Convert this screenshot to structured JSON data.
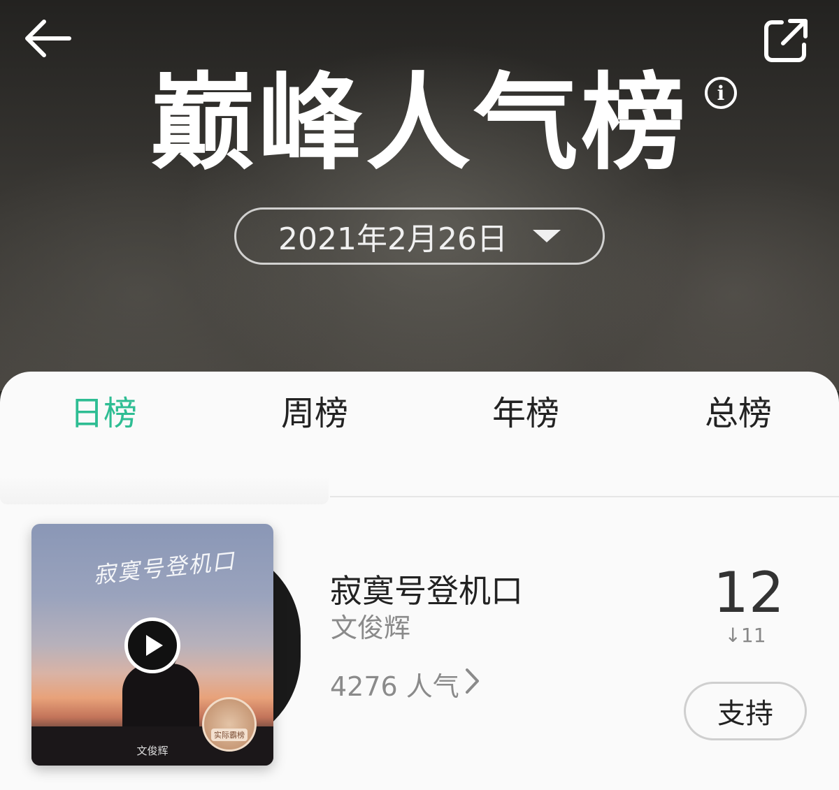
{
  "header": {
    "title": "巅峰人气榜",
    "date_label": "2021年2月26日",
    "info_icon": "info-icon",
    "back_icon": "arrow-left-icon",
    "share_icon": "share-external-icon"
  },
  "tabs": [
    {
      "label": "日榜",
      "active": true
    },
    {
      "label": "周榜",
      "active": false
    },
    {
      "label": "年榜",
      "active": false
    },
    {
      "label": "总榜",
      "active": false
    }
  ],
  "entry": {
    "cover_script": "寂寞号登机口",
    "cover_artist": "文俊辉",
    "cover_badge": "实际霸榜",
    "title": "寂寞号登机口",
    "artist": "文俊辉",
    "popularity": "4276 人气",
    "rank": "12",
    "rank_change": "↓11",
    "support_label": "支持"
  },
  "colors": {
    "accent": "#2ebd93",
    "sheet_bg": "#fafafa",
    "header_bg": "#2a2926"
  }
}
